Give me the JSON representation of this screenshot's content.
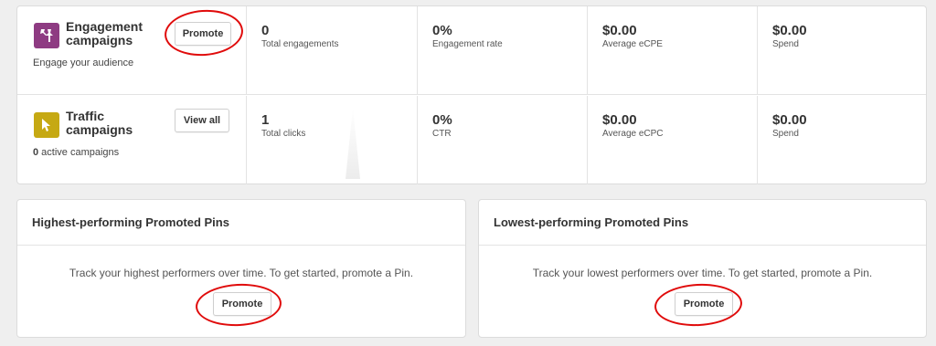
{
  "campaigns": [
    {
      "title": "Engagement campaigns",
      "subtitle": "Engage your audience",
      "icon": "pushpin-icon",
      "color": "#8e3b82",
      "button_label": "Promote",
      "stats": [
        {
          "value": "0",
          "label": "Total engagements"
        },
        {
          "value": "0%",
          "label": "Engagement rate"
        },
        {
          "value": "$0.00",
          "label": "Average eCPE"
        },
        {
          "value": "$0.00",
          "label": "Spend"
        }
      ]
    },
    {
      "title": "Traffic campaigns",
      "subtitle_count": "0",
      "subtitle_text": " active campaigns",
      "icon": "cursor-arrow-icon",
      "color": "#c6a913",
      "button_label": "View all",
      "stats": [
        {
          "value": "1",
          "label": "Total clicks"
        },
        {
          "value": "0%",
          "label": "CTR"
        },
        {
          "value": "$0.00",
          "label": "Average eCPC"
        },
        {
          "value": "$0.00",
          "label": "Spend"
        }
      ]
    }
  ],
  "highest": {
    "title": "Highest-performing Promoted Pins",
    "message": "Track your highest performers over time. To get started, promote a Pin.",
    "button_label": "Promote"
  },
  "lowest": {
    "title": "Lowest-performing Promoted Pins",
    "message": "Track your lowest performers over time. To get started, promote a Pin.",
    "button_label": "Promote"
  },
  "annotation_color": "#e00b0b"
}
